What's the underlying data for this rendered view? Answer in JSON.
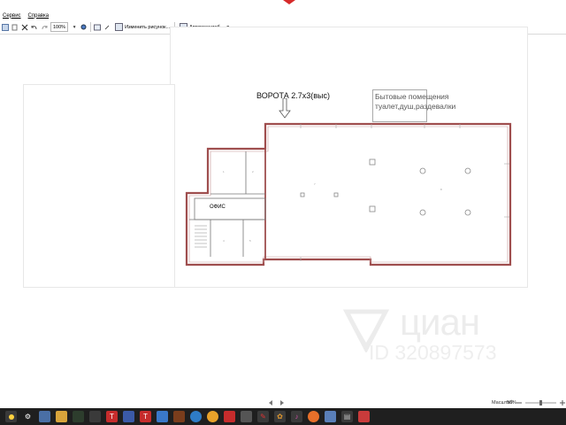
{
  "menu": {
    "service": "Сервис",
    "help": "Справка"
  },
  "toolbar": {
    "zoom_value": "100%",
    "resize_label": "Изменить рисунок...",
    "autoscale_label": "Автомасштаб"
  },
  "plan": {
    "gate_label": "ВОРОТА 2.7х3(выс)",
    "amenity_line1": "Бытовые помещения",
    "amenity_line2": "туалет,душ,раздевалки",
    "office_label": "ОФИС"
  },
  "watermark": {
    "brand": "циан",
    "id": "ID 320897573"
  },
  "status": {
    "scale_label": "Масштаб:",
    "scale_value": "56%"
  },
  "colors": {
    "wall": "#9f4e4e",
    "taskbar": "#1f1f1f",
    "accent_logo": "#d62a2a"
  },
  "taskbar_icons": [
    "start-icon",
    "gear-icon",
    "network-icon",
    "file-manager-icon",
    "terminal-icon",
    "terminal-icon",
    "te-icon",
    "chat-icon",
    "te-icon",
    "image-viewer-icon",
    "game-icon",
    "browser-icon",
    "chrome-icon",
    "media-icon",
    "calculator-icon",
    "feather-icon",
    "flower-icon",
    "music-icon",
    "firefox-icon",
    "gallery-icon",
    "app-icon",
    "presentation-icon"
  ]
}
